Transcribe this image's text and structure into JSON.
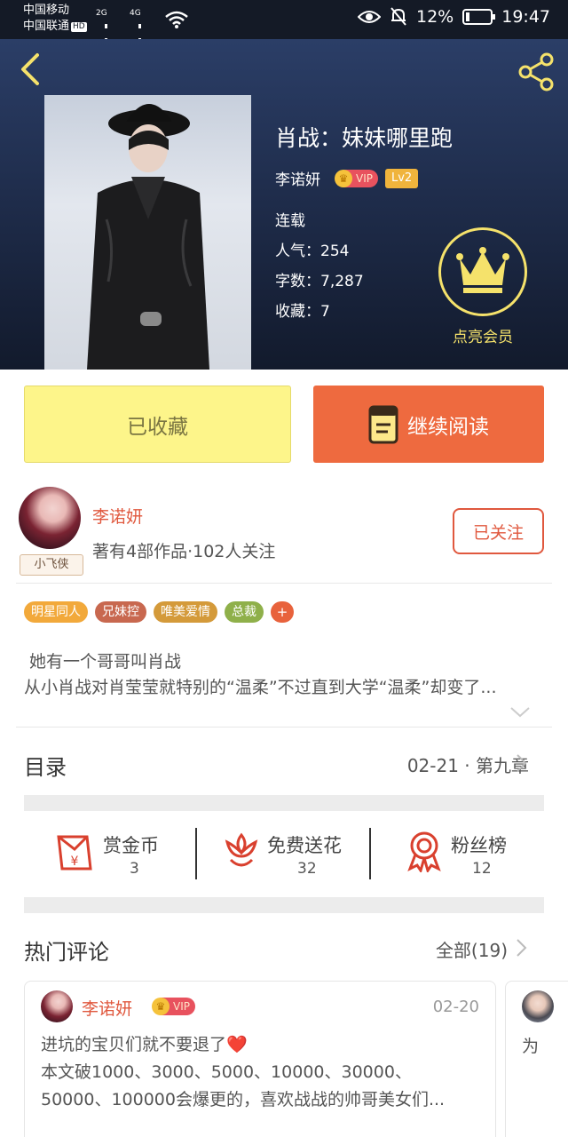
{
  "status_bar": {
    "carrier1": "中国移动",
    "carrier2": "中国联通",
    "hd": "HD",
    "net1": "2G",
    "net2": "4G",
    "battery": "12%",
    "time": "19:47"
  },
  "book": {
    "title": "肖战：妹妹哪里跑",
    "author": "李诺妍",
    "vip": "VIP",
    "level": "Lv2",
    "status": "连载",
    "popularity": "人气：254",
    "word_count": "字数：7,287",
    "favorites": "收藏：7",
    "member_label": "点亮会员"
  },
  "actions": {
    "collected": "已收藏",
    "continue_reading": "继续阅读"
  },
  "author_info": {
    "name": "李诺妍",
    "stats": "著有4部作品·102人关注",
    "badge": "小飞侠",
    "follow": "已关注"
  },
  "tags": [
    {
      "label": "明星同人",
      "color": "#f2a93b"
    },
    {
      "label": "兄妹控",
      "color": "#c8684f"
    },
    {
      "label": "唯美爱情",
      "color": "#d49a3a"
    },
    {
      "label": "总裁",
      "color": "#8fb04a"
    }
  ],
  "tag_plus": "+",
  "intro": {
    "line1": "她有一个哥哥叫肖战",
    "line2": "从小肖战对肖莹莹就特别的“温柔”不过直到大学“温柔”却变了..."
  },
  "toc": {
    "title": "目录",
    "latest": "02-21 · 第九章"
  },
  "rewards": [
    {
      "label": "赏金币",
      "value": "3"
    },
    {
      "label": "免费送花",
      "value": "32"
    },
    {
      "label": "粉丝榜",
      "value": "12"
    }
  ],
  "comments_section": {
    "title": "热门评论",
    "all": "全部(19)"
  },
  "comments": [
    {
      "name": "李诺妍",
      "vip": "VIP",
      "date": "02-20",
      "line1": "进坑的宝贝们就不要退了❤️",
      "line2": "本文破1000、3000、5000、10000、30000、",
      "line3": "50000、100000会爆更的，喜欢战战的帅哥美女们..."
    },
    {
      "text": "为"
    }
  ],
  "colors": {
    "accent": "#e0583e",
    "read_button": "#ee6a3f",
    "collected_button": "#fdf58a",
    "crown": "#f5e26b"
  }
}
